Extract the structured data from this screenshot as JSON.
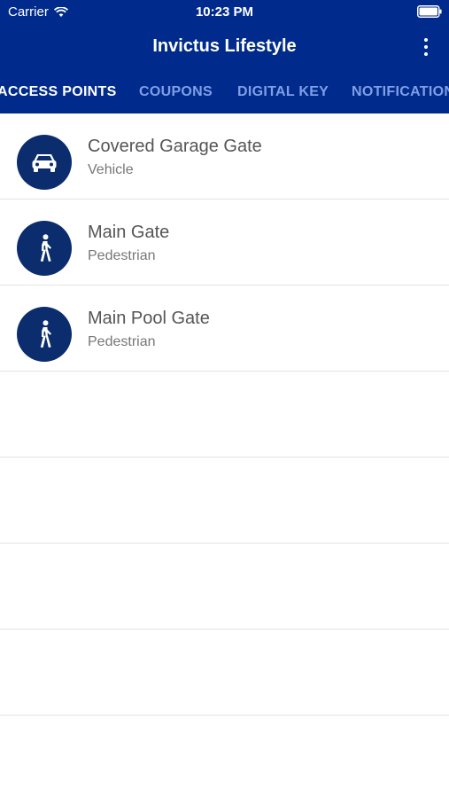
{
  "status_bar": {
    "carrier": "Carrier",
    "time": "10:23 PM"
  },
  "header": {
    "title": "Invictus Lifestyle"
  },
  "tabs": [
    {
      "label": "ACCESS POINTS"
    },
    {
      "label": "COUPONS"
    },
    {
      "label": "DIGITAL KEY"
    },
    {
      "label": "NOTIFICATIONS"
    }
  ],
  "access_points": [
    {
      "name": "Covered Garage Gate",
      "type": "Vehicle",
      "icon": "car-icon"
    },
    {
      "name": "Main Gate",
      "type": "Pedestrian",
      "icon": "pedestrian-icon"
    },
    {
      "name": "Main Pool Gate",
      "type": "Pedestrian",
      "icon": "pedestrian-icon"
    }
  ],
  "colors": {
    "brand": "#002b8c",
    "icon_circle": "#0b2d6e",
    "tab_inactive": "#7f9fe6",
    "tab_active": "#ffffff"
  }
}
